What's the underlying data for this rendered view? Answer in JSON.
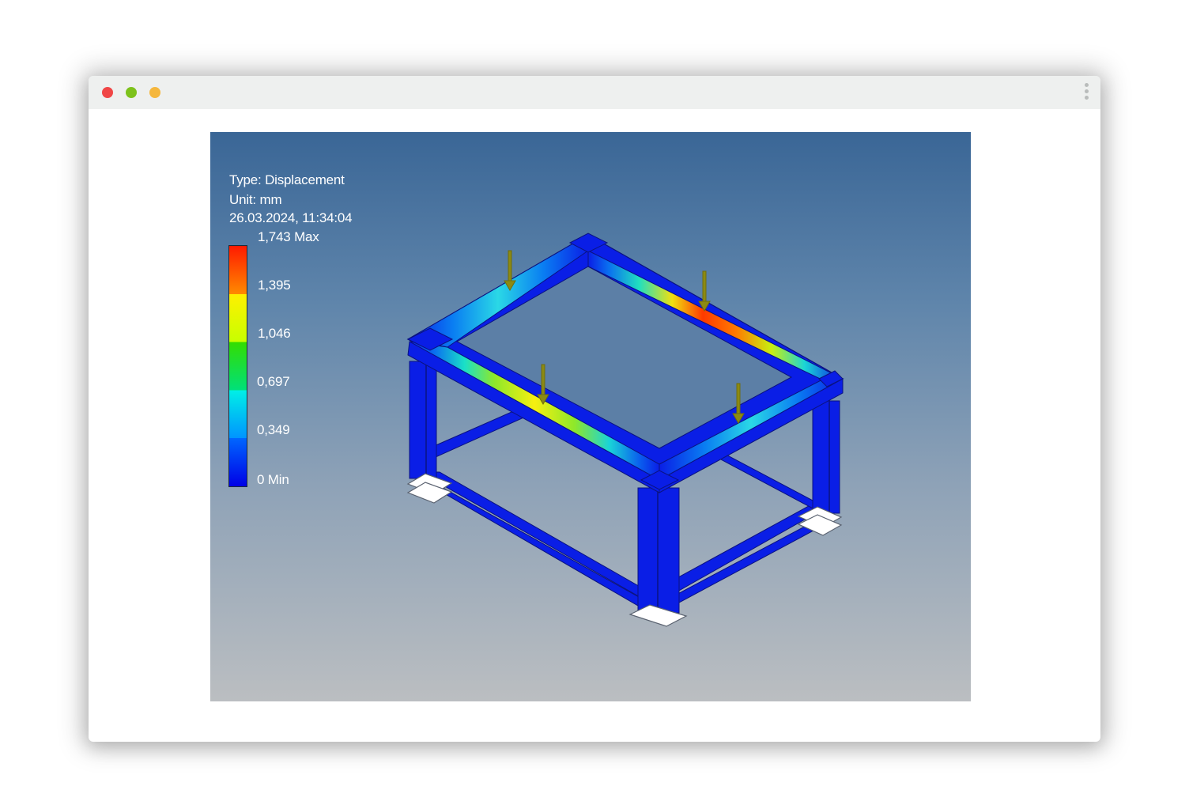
{
  "window": {
    "controls": [
      "close",
      "minimize",
      "maximize"
    ],
    "menu_icon": "kebab-menu-icon"
  },
  "legend": {
    "type_label": "Type: Displacement",
    "unit_label": "Unit: mm",
    "timestamp": "26.03.2024, 11:34:04",
    "scale": [
      {
        "value": "1,743 Max"
      },
      {
        "value": "1,395"
      },
      {
        "value": "1,046"
      },
      {
        "value": "0,697"
      },
      {
        "value": "0,349"
      },
      {
        "value": "0 Min"
      }
    ]
  },
  "colors": {
    "frame_base": "#0a1ee6",
    "load_arrow": "#8c8a12",
    "max_stress": "#ff1a00",
    "min_stress": "#0000e6"
  }
}
